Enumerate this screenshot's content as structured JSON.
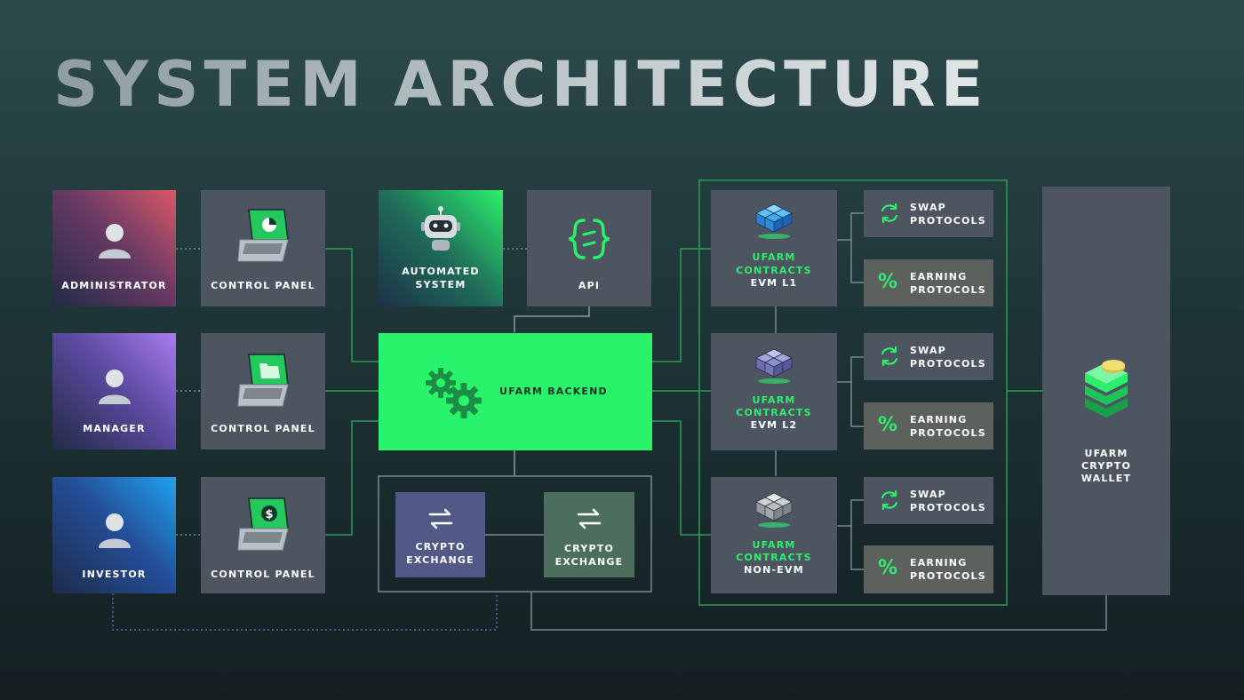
{
  "title": "SYSTEM ARCHITECTURE",
  "colors": {
    "accent_green": "#2cf06b",
    "node_grey": "#4c5560",
    "earning_grey": "#5d615d",
    "exchange_blue": "#515a86",
    "exchange_green": "#4c6f5d"
  },
  "users": [
    {
      "label": "ADMINISTRATOR",
      "icon": "user-icon"
    },
    {
      "label": "MANAGER",
      "icon": "user-icon"
    },
    {
      "label": "INVESTOR",
      "icon": "user-icon"
    }
  ],
  "control_panels": [
    {
      "label": "CONTROL PANEL",
      "icon": "laptop-chart-icon"
    },
    {
      "label": "CONTROL PANEL",
      "icon": "laptop-folder-icon"
    },
    {
      "label": "CONTROL PANEL",
      "icon": "laptop-dollar-icon"
    }
  ],
  "automated_system": {
    "label_line1": "AUTOMATED",
    "label_line2": "SYSTEM",
    "icon": "robot-icon"
  },
  "api": {
    "label": "API",
    "icon": "api-icon"
  },
  "backend": {
    "label": "UFARM BACKEND",
    "icon": "gears-icon"
  },
  "exchanges": [
    {
      "label_line1": "CRYPTO",
      "label_line2": "EXCHANGE",
      "icon": "exchange-arrows-icon"
    },
    {
      "label_line1": "CRYPTO",
      "label_line2": "EXCHANGE",
      "icon": "exchange-arrows-icon"
    }
  ],
  "contracts": [
    {
      "line1": "UFARM",
      "line2": "CONTRACTS",
      "line3": "EVM L1",
      "icon": "cubes-blue-icon"
    },
    {
      "line1": "UFARM",
      "line2": "CONTRACTS",
      "line3": "EVM L2",
      "icon": "cubes-purple-icon"
    },
    {
      "line1": "UFARM",
      "line2": "CONTRACTS",
      "line3": "NON-EVM",
      "icon": "cubes-grey-icon"
    }
  ],
  "protocols": [
    {
      "swap": [
        "SWAP",
        "PROTOCOLS"
      ],
      "earning": [
        "EARNING",
        "PROTOCOLS"
      ]
    },
    {
      "swap": [
        "SWAP",
        "PROTOCOLS"
      ],
      "earning": [
        "EARNING",
        "PROTOCOLS"
      ]
    },
    {
      "swap": [
        "SWAP",
        "PROTOCOLS"
      ],
      "earning": [
        "EARNING",
        "PROTOCOLS"
      ]
    }
  ],
  "protocol_icons": {
    "swap": "refresh-icon",
    "earning": "%"
  },
  "wallet": {
    "line1": "UFARM",
    "line2": "CRYPTO",
    "line3": "WALLET",
    "icon": "wallet-stack-icon"
  }
}
